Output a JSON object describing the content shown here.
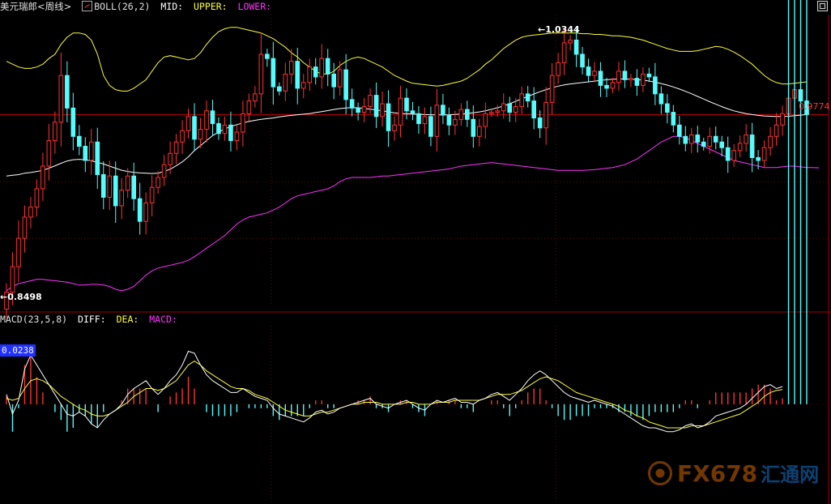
{
  "header_boll": {
    "name": "美元瑞郎<周线>",
    "indicator": "BOLL(26,2)",
    "mid": "MID:",
    "upper": "UPPER:",
    "lower": "LOWER:"
  },
  "header_macd": {
    "indicator": "MACD(23,5,8)",
    "diff": "DIFF:",
    "dea": "DEA:",
    "macd": "MACD:"
  },
  "labels": {
    "high": "1.0344",
    "low": "0.8498",
    "last": "0.9774",
    "macd_value": "0.0238"
  },
  "watermark": {
    "text": "FX678",
    "sub": "汇通网"
  },
  "colors": {
    "background": "#000000",
    "up": "#ff3232",
    "down": "#54fcfc",
    "mid": "#ffffff",
    "upper": "#ffff33",
    "lower": "#ff33ff",
    "grid": "#8b0000"
  },
  "chart_data": [
    {
      "type": "candlestick",
      "title": "美元瑞郎<周线>",
      "indicator": "BOLL(26,2)",
      "ylim": [
        0.842,
        1.048
      ],
      "current_price": 0.9774,
      "high_marked": 1.0344,
      "low_marked": 0.8498,
      "closes": [
        0.852,
        0.87,
        0.89,
        0.905,
        0.912,
        0.925,
        0.941,
        0.959,
        0.972,
        1.005,
        0.982,
        0.962,
        0.955,
        0.945,
        0.958,
        0.935,
        0.919,
        0.934,
        0.913,
        0.924,
        0.934,
        0.918,
        0.902,
        0.915,
        0.926,
        0.933,
        0.942,
        0.95,
        0.958,
        0.966,
        0.976,
        0.96,
        0.967,
        0.98,
        0.971,
        0.964,
        0.97,
        0.959,
        0.965,
        0.978,
        0.987,
        0.992,
        1.02,
        1.017,
        0.997,
        0.994,
        1.006,
        1.015,
        0.996,
        1.0,
        1.011,
        1.004,
        1.017,
        1.006,
        0.997,
        1.009,
        0.988,
        0.982,
        0.979,
        0.983,
        0.991,
        0.976,
        0.985,
        0.966,
        0.97,
        0.989,
        0.98,
        0.978,
        0.971,
        0.976,
        0.962,
        0.984,
        0.977,
        0.97,
        0.974,
        0.981,
        0.974,
        0.962,
        0.969,
        0.978,
        0.979,
        0.98,
        0.985,
        0.979,
        0.983,
        0.992,
        0.987,
        0.975,
        0.968,
        0.986,
        1.005,
        1.014,
        1.028,
        1.03,
        1.02,
        1.011,
        1.005,
        1.008,
        0.998,
        0.996,
        1.0,
        1.008,
        1.002,
        1.003,
        0.998,
        1.006,
        1.004,
        0.992,
        0.985,
        0.979,
        0.97,
        0.962,
        0.957,
        0.963,
        0.958,
        0.955,
        0.962,
        0.958,
        0.954,
        0.945,
        0.952,
        0.957,
        0.963,
        0.947,
        0.945,
        0.954,
        0.962,
        0.97,
        0.978,
        0.989,
        0.995,
        0.987,
        0.9774
      ],
      "mid": [
        0.934,
        0.9345,
        0.935,
        0.936,
        0.9365,
        0.9372,
        0.938,
        0.9395,
        0.9412,
        0.943,
        0.9446,
        0.9455,
        0.9458,
        0.9454,
        0.9447,
        0.9437,
        0.9425,
        0.941,
        0.9395,
        0.9381,
        0.9372,
        0.9366,
        0.9362,
        0.936,
        0.9358,
        0.936,
        0.9372,
        0.9388,
        0.9412,
        0.944,
        0.9475,
        0.952,
        0.9555,
        0.959,
        0.9625,
        0.965,
        0.9672,
        0.969,
        0.9703,
        0.9715,
        0.9725,
        0.9733,
        0.974,
        0.9745,
        0.975,
        0.9757,
        0.9763,
        0.9768,
        0.9773,
        0.9777,
        0.9781,
        0.9788,
        0.9795,
        0.9802,
        0.981,
        0.9816,
        0.982,
        0.9823,
        0.9822,
        0.9818,
        0.9812,
        0.9806,
        0.98,
        0.9793,
        0.9786,
        0.9782,
        0.978,
        0.9778,
        0.9776,
        0.9774,
        0.9773,
        0.9772,
        0.9772,
        0.9773,
        0.9775,
        0.9778,
        0.9782,
        0.9787,
        0.9793,
        0.9801,
        0.9811,
        0.9822,
        0.9835,
        0.985,
        0.9868,
        0.9885,
        0.9902,
        0.9919,
        0.9935,
        0.995,
        0.9963,
        0.9975,
        0.9984,
        0.999,
        0.9995,
        1.0,
        1.0005,
        1.001,
        1.0015,
        1.002,
        1.0023,
        1.0025,
        1.0025,
        1.0024,
        1.0021,
        1.0017,
        1.0011,
        1.0003,
        0.9993,
        0.9982,
        0.9969,
        0.9954,
        0.9938,
        0.9921,
        0.9902,
        0.9884,
        0.9865,
        0.9847,
        0.983,
        0.9814,
        0.98,
        0.979,
        0.9781,
        0.9774,
        0.9768,
        0.9764,
        0.9762,
        0.976,
        0.976,
        0.9762,
        0.9766,
        0.977,
        0.9774
      ],
      "upper": [
        1.015,
        1.013,
        1.011,
        1.01,
        1.01,
        1.011,
        1.013,
        1.017,
        1.02,
        1.027,
        1.032,
        1.035,
        1.035,
        1.034,
        1.03,
        1.02,
        1.005,
        0.998,
        0.995,
        0.994,
        0.994,
        0.996,
        0.999,
        1.002,
        1.008,
        1.014,
        1.018,
        1.019,
        1.018,
        1.017,
        1.016,
        1.017,
        1.021,
        1.027,
        1.032,
        1.036,
        1.038,
        1.039,
        1.039,
        1.038,
        1.037,
        1.036,
        1.035,
        1.033,
        1.031,
        1.028,
        1.025,
        1.021,
        1.018,
        1.014,
        1.011,
        1.008,
        1.006,
        1.006,
        1.008,
        1.012,
        1.015,
        1.017,
        1.018,
        1.017,
        1.015,
        1.013,
        1.011,
        1.008,
        1.005,
        1.003,
        1.001,
        0.9995,
        0.999,
        0.9985,
        0.998,
        0.9975,
        0.998,
        0.999,
        1.0,
        1.001,
        1.003,
        1.006,
        1.009,
        1.013,
        1.016,
        1.02,
        1.024,
        1.027,
        1.03,
        1.032,
        1.033,
        1.0335,
        1.034,
        1.0345,
        1.035,
        1.035,
        1.035,
        1.035,
        1.035,
        1.0345,
        1.0345,
        1.034,
        1.034,
        1.0335,
        1.033,
        1.033,
        1.0325,
        1.032,
        1.031,
        1.03,
        1.0285,
        1.027,
        1.0255,
        1.024,
        1.023,
        1.022,
        1.022,
        1.022,
        1.0225,
        1.0235,
        1.0245,
        1.0255,
        1.025,
        1.0235,
        1.0215,
        1.019,
        1.016,
        1.013,
        1.009,
        1.005,
        1.002,
        1.0,
        0.999,
        0.999,
        0.9995,
        1.0,
        1.0005
      ],
      "lower": [
        0.853,
        0.856,
        0.858,
        0.859,
        0.86,
        0.861,
        0.861,
        0.8605,
        0.86,
        0.8595,
        0.859,
        0.858,
        0.857,
        0.857,
        0.8575,
        0.8575,
        0.857,
        0.856,
        0.854,
        0.853,
        0.854,
        0.856,
        0.86,
        0.864,
        0.867,
        0.869,
        0.87,
        0.871,
        0.872,
        0.873,
        0.8745,
        0.877,
        0.88,
        0.883,
        0.886,
        0.889,
        0.892,
        0.896,
        0.9,
        0.903,
        0.905,
        0.906,
        0.907,
        0.908,
        0.91,
        0.912,
        0.915,
        0.918,
        0.92,
        0.921,
        0.922,
        0.923,
        0.924,
        0.925,
        0.927,
        0.93,
        0.932,
        0.933,
        0.933,
        0.933,
        0.933,
        0.9335,
        0.934,
        0.934,
        0.9345,
        0.935,
        0.9355,
        0.936,
        0.9365,
        0.937,
        0.9375,
        0.938,
        0.9385,
        0.939,
        0.94,
        0.941,
        0.9415,
        0.942,
        0.9425,
        0.943,
        0.9435,
        0.943,
        0.9425,
        0.942,
        0.9415,
        0.941,
        0.9405,
        0.94,
        0.9395,
        0.939,
        0.9385,
        0.938,
        0.938,
        0.938,
        0.938,
        0.938,
        0.9382,
        0.9385,
        0.939,
        0.9395,
        0.94,
        0.941,
        0.942,
        0.944,
        0.946,
        0.949,
        0.952,
        0.955,
        0.958,
        0.96,
        0.962,
        0.962,
        0.961,
        0.959,
        0.957,
        0.955,
        0.953,
        0.951,
        0.949,
        0.947,
        0.945,
        0.944,
        0.943,
        0.942,
        0.941,
        0.94,
        0.94,
        0.94,
        0.9405,
        0.941,
        0.941,
        0.9405,
        0.94,
        0.94,
        0.9398
      ]
    },
    {
      "type": "macd",
      "indicator": "MACD(23,5,8)",
      "ylim": [
        -0.05,
        0.04
      ],
      "diff": [
        0.005,
        -0.005,
        0.002,
        0.018,
        0.025,
        0.02,
        0.015,
        0.01,
        0.005,
        0.0,
        -0.005,
        -0.006,
        -0.004,
        -0.006,
        -0.01,
        -0.012,
        -0.008,
        -0.005,
        -0.003,
        0.0,
        0.005,
        0.008,
        0.01,
        0.012,
        0.008,
        0.005,
        0.008,
        0.012,
        0.015,
        0.02,
        0.027,
        0.026,
        0.02,
        0.015,
        0.012,
        0.01,
        0.008,
        0.006,
        0.006,
        0.008,
        0.006,
        0.004,
        0.003,
        0.002,
        -0.002,
        -0.005,
        -0.006,
        -0.007,
        -0.008,
        -0.009,
        -0.007,
        -0.004,
        -0.003,
        -0.005,
        -0.004,
        -0.002,
        -0.001,
        0.0,
        0.001,
        0.002,
        0.003,
        0.0,
        -0.001,
        -0.002,
        0.0,
        0.001,
        0.002,
        0.0,
        -0.002,
        -0.003,
        0.0,
        0.002,
        0.001,
        0.002,
        0.003,
        0.001,
        0.001,
        0.0,
        0.002,
        0.003,
        0.005,
        0.006,
        0.004,
        0.002,
        0.005,
        0.008,
        0.012,
        0.015,
        0.017,
        0.015,
        0.012,
        0.009,
        0.006,
        0.004,
        0.003,
        0.002,
        0.001,
        0.002,
        0.001,
        0.0,
        -0.001,
        -0.003,
        -0.005,
        -0.007,
        -0.009,
        -0.011,
        -0.012,
        -0.012,
        -0.013,
        -0.014,
        -0.014,
        -0.013,
        -0.011,
        -0.01,
        -0.012,
        -0.011,
        -0.009,
        -0.006,
        -0.005,
        -0.004,
        -0.003,
        -0.002,
        0.0,
        0.003,
        0.006,
        0.009,
        0.01,
        0.008,
        0.009
      ],
      "dea": [
        0.003,
        0.002,
        0.003,
        0.008,
        0.012,
        0.013,
        0.012,
        0.01,
        0.007,
        0.004,
        0.002,
        0.0,
        -0.002,
        -0.003,
        -0.005,
        -0.006,
        -0.006,
        -0.005,
        -0.003,
        -0.001,
        0.001,
        0.004,
        0.006,
        0.008,
        0.008,
        0.007,
        0.008,
        0.01,
        0.012,
        0.016,
        0.02,
        0.022,
        0.02,
        0.017,
        0.015,
        0.013,
        0.011,
        0.009,
        0.008,
        0.008,
        0.007,
        0.005,
        0.004,
        0.003,
        0.001,
        -0.001,
        -0.003,
        -0.004,
        -0.005,
        -0.006,
        -0.006,
        -0.005,
        -0.004,
        -0.004,
        -0.003,
        -0.002,
        -0.001,
        0.0,
        0.0,
        0.001,
        0.001,
        0.001,
        0.0,
        0.0,
        0.0,
        0.0,
        0.001,
        0.001,
        0.0,
        0.0,
        0.0,
        0.001,
        0.001,
        0.001,
        0.002,
        0.002,
        0.002,
        0.002,
        0.002,
        0.003,
        0.004,
        0.005,
        0.005,
        0.005,
        0.006,
        0.007,
        0.009,
        0.011,
        0.013,
        0.014,
        0.013,
        0.012,
        0.01,
        0.008,
        0.006,
        0.005,
        0.004,
        0.003,
        0.002,
        0.001,
        0.0,
        -0.001,
        -0.003,
        -0.004,
        -0.006,
        -0.007,
        -0.009,
        -0.01,
        -0.011,
        -0.012,
        -0.012,
        -0.012,
        -0.012,
        -0.011,
        -0.011,
        -0.011,
        -0.01,
        -0.009,
        -0.008,
        -0.007,
        -0.006,
        -0.005,
        -0.003,
        -0.001,
        0.001,
        0.004,
        0.006,
        0.007,
        0.0075
      ],
      "current_macd": 0.0238
    }
  ]
}
